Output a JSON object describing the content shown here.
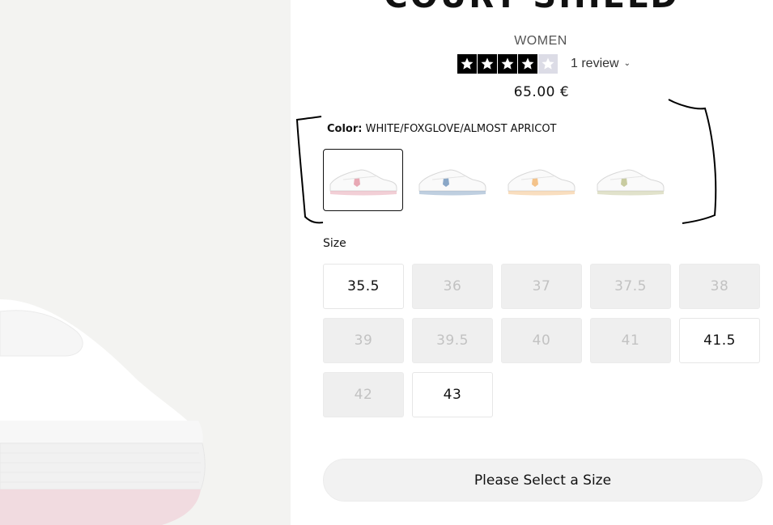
{
  "product": {
    "title": "COURT SHIELD",
    "gender": "WOMEN",
    "rating": 4,
    "rating_max": 5,
    "review_label": "1 review",
    "price": "65.00 €"
  },
  "color": {
    "label": "Color:",
    "value": "WHITE/FOXGLOVE/ALMOST APRICOT",
    "swatches": [
      {
        "accent": "#e8a8b4",
        "selected": true
      },
      {
        "accent": "#8aa7c7",
        "selected": false
      },
      {
        "accent": "#f4c38a",
        "selected": false
      },
      {
        "accent": "#c8cba0",
        "selected": false
      }
    ]
  },
  "size": {
    "label": "Size",
    "options": [
      {
        "value": "35.5",
        "available": true
      },
      {
        "value": "36",
        "available": false
      },
      {
        "value": "37",
        "available": false
      },
      {
        "value": "37.5",
        "available": false
      },
      {
        "value": "38",
        "available": false
      },
      {
        "value": "39",
        "available": false
      },
      {
        "value": "39.5",
        "available": false
      },
      {
        "value": "40",
        "available": false
      },
      {
        "value": "41",
        "available": false
      },
      {
        "value": "41.5",
        "available": true
      },
      {
        "value": "42",
        "available": false
      },
      {
        "value": "43",
        "available": true
      }
    ]
  },
  "cta": {
    "label": "Please Select a Size"
  },
  "colors": {
    "unavailable_text": "#c2c2c2",
    "star": "#000000",
    "star_empty": "#dcdce6"
  }
}
